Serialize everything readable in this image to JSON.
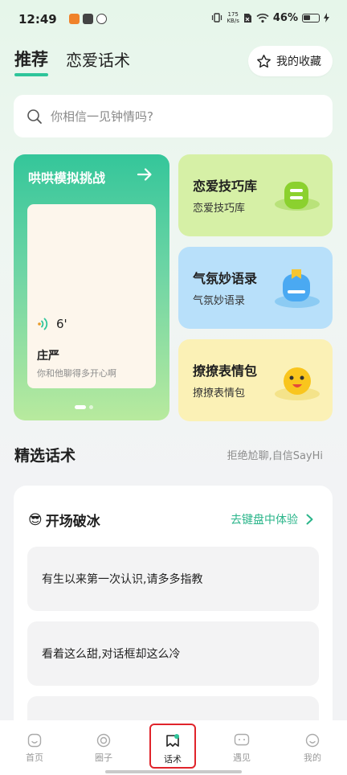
{
  "status_bar": {
    "time": "12:49",
    "net_speed_value": "175",
    "net_speed_unit": "KB/s",
    "battery": "46%"
  },
  "header": {
    "tabs": [
      {
        "label": "推荐",
        "active": true
      },
      {
        "label": "恋爱话术",
        "active": false
      }
    ],
    "favorites_label": "我的收藏"
  },
  "search": {
    "placeholder": "你相信一见钟情吗?"
  },
  "challenge_card": {
    "title": "哄哄模拟挑战",
    "voice_duration": "6'",
    "persona_name": "庄严",
    "persona_sub": "你和他聊得多开心啊"
  },
  "feature_cards": [
    {
      "title": "恋爱技巧库",
      "subtitle": "恋爱技巧库",
      "bg": "#d6f0a6"
    },
    {
      "title": "气氛妙语录",
      "subtitle": "气氛妙语录",
      "bg": "#b8e0fa"
    },
    {
      "title": "撩撩表情包",
      "subtitle": "撩撩表情包",
      "bg": "#fbf1b6"
    }
  ],
  "section": {
    "title": "精选话术",
    "subtitle": "拒绝尬聊,自信SayHi"
  },
  "phrase_panel": {
    "emoji": "😎",
    "title": "开场破冰",
    "link_label": "去键盘中体验",
    "phrases": [
      "有生以来第一次认识,请多多指教",
      "看着这么甜,对话框却这么冷"
    ]
  },
  "bottom_nav": {
    "items": [
      {
        "label": "首页",
        "icon": "home-icon",
        "active": false
      },
      {
        "label": "圈子",
        "icon": "circle-icon",
        "active": false
      },
      {
        "label": "话术",
        "icon": "speech-icon",
        "active": true
      },
      {
        "label": "遇见",
        "icon": "meet-icon",
        "active": false
      },
      {
        "label": "我的",
        "icon": "profile-icon",
        "active": false
      }
    ]
  },
  "colors": {
    "accent": "#2ec59a",
    "link": "#2ab58a",
    "highlight_box": "#e0242b"
  }
}
